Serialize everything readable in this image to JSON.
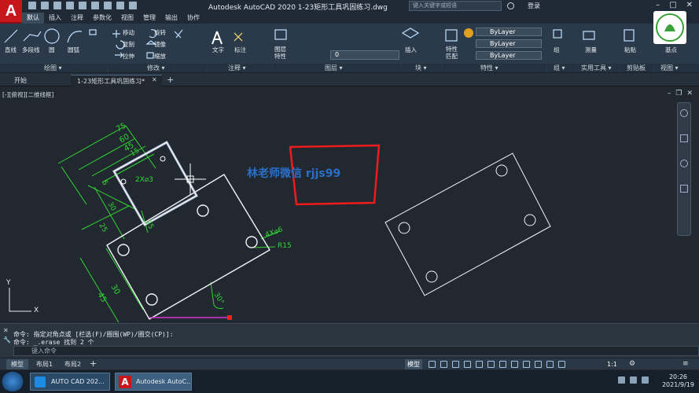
{
  "app": {
    "title": "Autodesk AutoCAD 2020    1-23矩形工具巩固练习.dwg",
    "search_placeholder": "键入关键字或短语",
    "login": "登录"
  },
  "ribbon_tabs": [
    "默认",
    "插入",
    "注释",
    "参数化",
    "视图",
    "管理",
    "输出",
    "协作"
  ],
  "draw_tools": {
    "line": "直线",
    "polyline": "多段线",
    "circle": "圆",
    "arc": "圆弧"
  },
  "modify_tools": {
    "move": "移动",
    "rotate": "旋转",
    "copy": "复制",
    "mirror": "镜像",
    "stretch": "拉伸",
    "scale": "缩放"
  },
  "annotation_tools": {
    "text": "文字",
    "dimension": "标注"
  },
  "layer_tools": {
    "properties": "图层\n特性",
    "current": "0"
  },
  "block_tools": {
    "insert": "插入"
  },
  "properties_tools": {
    "match": "特性\n匹配",
    "bylayer": "ByLayer"
  },
  "group_tools": {
    "group": "组"
  },
  "utility_tools": {
    "measure": "测量"
  },
  "clipboard_tools": {
    "paste": "粘贴"
  },
  "view_tools": {
    "base": "基点"
  },
  "panel_titles": [
    "绘图 ▾",
    "修改 ▾",
    "注释 ▾",
    "图层 ▾",
    "块 ▾",
    "特性 ▾",
    "组 ▾",
    "实用工具 ▾",
    "剪贴板",
    "视图 ▾"
  ],
  "file_tabs": [
    "开始",
    "1-23矩形工具巩固练习*"
  ],
  "viewport_label": "[-][俯视][二维线框]",
  "drawing": {
    "dims": {
      "d75": "75",
      "d60": "60",
      "d45": "45",
      "d5": "5",
      "d15": "15",
      "d30": "30",
      "d25a": "25",
      "d25b": "25",
      "d45b": "45",
      "d30b": "30",
      "angle": "30°"
    },
    "notes": {
      "holes2": "2X⌀3",
      "holes4": "4X⌀6",
      "radius": "R15"
    },
    "watermark": "林老师微信 rjjs99",
    "axis": {
      "y": "Y",
      "x": "X"
    }
  },
  "command": {
    "line1": "命令: 指定对角点或 [栏选(F)/圈围(WP)/圈交(CP)]:",
    "line2": "命令: _.erase 找到 2 个",
    "placeholder": "键入命令"
  },
  "layout_tabs": [
    "模型",
    "布局1",
    "布局2"
  ],
  "status": {
    "model": "模型",
    "scale": "1:1"
  },
  "taskbar": {
    "item1": "AUTO  CAD 202...",
    "item2": "Autodesk AutoC...",
    "time": "20:26",
    "date": "2021/9/19"
  }
}
